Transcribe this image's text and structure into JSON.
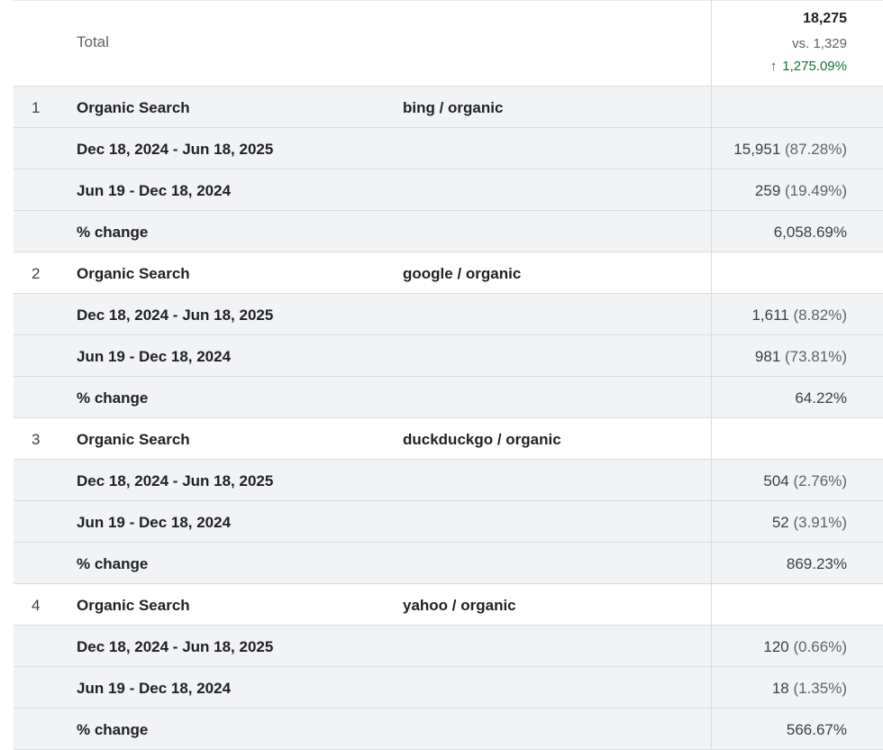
{
  "total": {
    "label": "Total",
    "value": "18,275",
    "vs": "vs. 1,329",
    "change": "1,275.09%",
    "change_color": "#137333"
  },
  "groups": [
    {
      "rank": "1",
      "channel": "Organic Search",
      "source": "bing / organic",
      "current_label": "Dec 18, 2024 - Jun 18, 2025",
      "current_value": "15,951",
      "current_pct": "(87.28%)",
      "previous_label": "Jun 19 - Dec 18, 2024",
      "previous_value": "259",
      "previous_pct": "(19.49%)",
      "change_label": "% change",
      "change_value": "6,058.69%"
    },
    {
      "rank": "2",
      "channel": "Organic Search",
      "source": "google / organic",
      "current_label": "Dec 18, 2024 - Jun 18, 2025",
      "current_value": "1,611",
      "current_pct": "(8.82%)",
      "previous_label": "Jun 19 - Dec 18, 2024",
      "previous_value": "981",
      "previous_pct": "(73.81%)",
      "change_label": "% change",
      "change_value": "64.22%"
    },
    {
      "rank": "3",
      "channel": "Organic Search",
      "source": "duckduckgo / organic",
      "current_label": "Dec 18, 2024 - Jun 18, 2025",
      "current_value": "504",
      "current_pct": "(2.76%)",
      "previous_label": "Jun 19 - Dec 18, 2024",
      "previous_value": "52",
      "previous_pct": "(3.91%)",
      "change_label": "% change",
      "change_value": "869.23%"
    },
    {
      "rank": "4",
      "channel": "Organic Search",
      "source": "yahoo / organic",
      "current_label": "Dec 18, 2024 - Jun 18, 2025",
      "current_value": "120",
      "current_pct": "(0.66%)",
      "previous_label": "Jun 19 - Dec 18, 2024",
      "previous_value": "18",
      "previous_pct": "(1.35%)",
      "change_label": "% change",
      "change_value": "566.67%"
    }
  ],
  "colors": {
    "row_alt": "#f1f3f4",
    "border": "#dadce0",
    "positive": "#137333"
  }
}
